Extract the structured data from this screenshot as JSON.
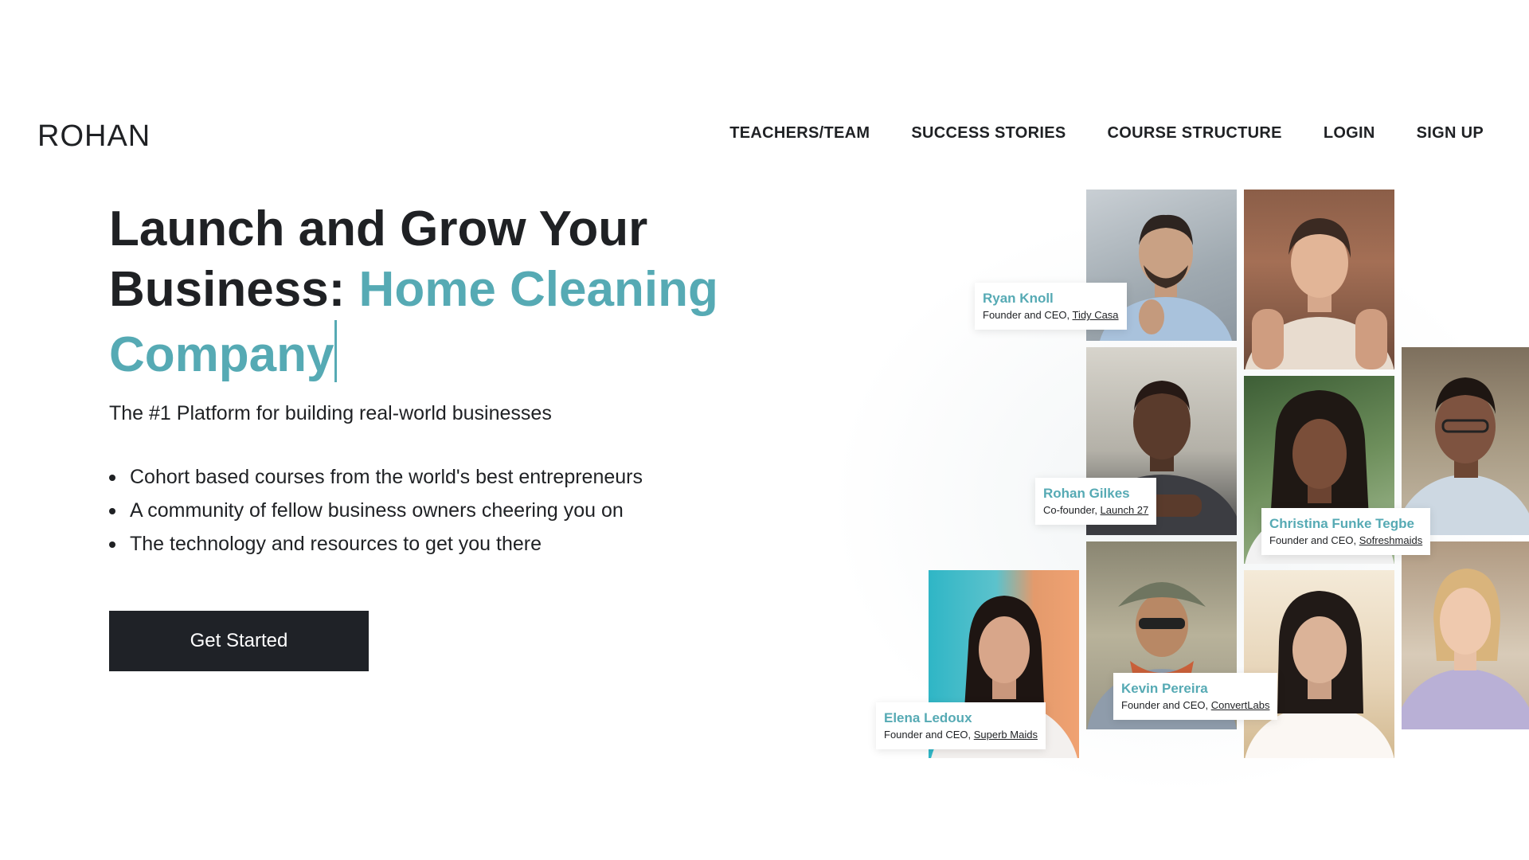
{
  "brand": {
    "logo": "ROHAN"
  },
  "nav": {
    "items": [
      {
        "label": "TEACHERS/TEAM"
      },
      {
        "label": "SUCCESS STORIES"
      },
      {
        "label": "COURSE STRUCTURE"
      },
      {
        "label": "LOGIN"
      },
      {
        "label": "SIGN UP"
      }
    ]
  },
  "hero": {
    "headline_dark": "Launch and Grow Your Business: ",
    "headline_accent": "Home Cleaning Company",
    "subtitle": "The #1 Platform for building real-world businesses",
    "bullets": [
      "Cohort based courses from the world's best entrepreneurs",
      "A community of fellow business owners cheering you on",
      "The technology and resources to get you there"
    ],
    "cta_label": "Get Started"
  },
  "people": [
    {
      "name": "Ryan Knoll",
      "role": "Founder and CEO, ",
      "company": "Tidy Casa"
    },
    {
      "name": "Rohan Gilkes",
      "role": "Co-founder, ",
      "company": "Launch 27"
    },
    {
      "name": "Christina Funke Tegbe",
      "role": "Founder and CEO, ",
      "company": "Sofreshmaids"
    },
    {
      "name": "Kevin Pereira",
      "role": "Founder and CEO, ",
      "company": "ConvertLabs"
    },
    {
      "name": "Elena Ledoux",
      "role": "Founder and CEO, ",
      "company": "Superb Maids"
    }
  ],
  "colors": {
    "accent": "#56aab4",
    "dark": "#1f2227",
    "background": "#ffffff"
  }
}
